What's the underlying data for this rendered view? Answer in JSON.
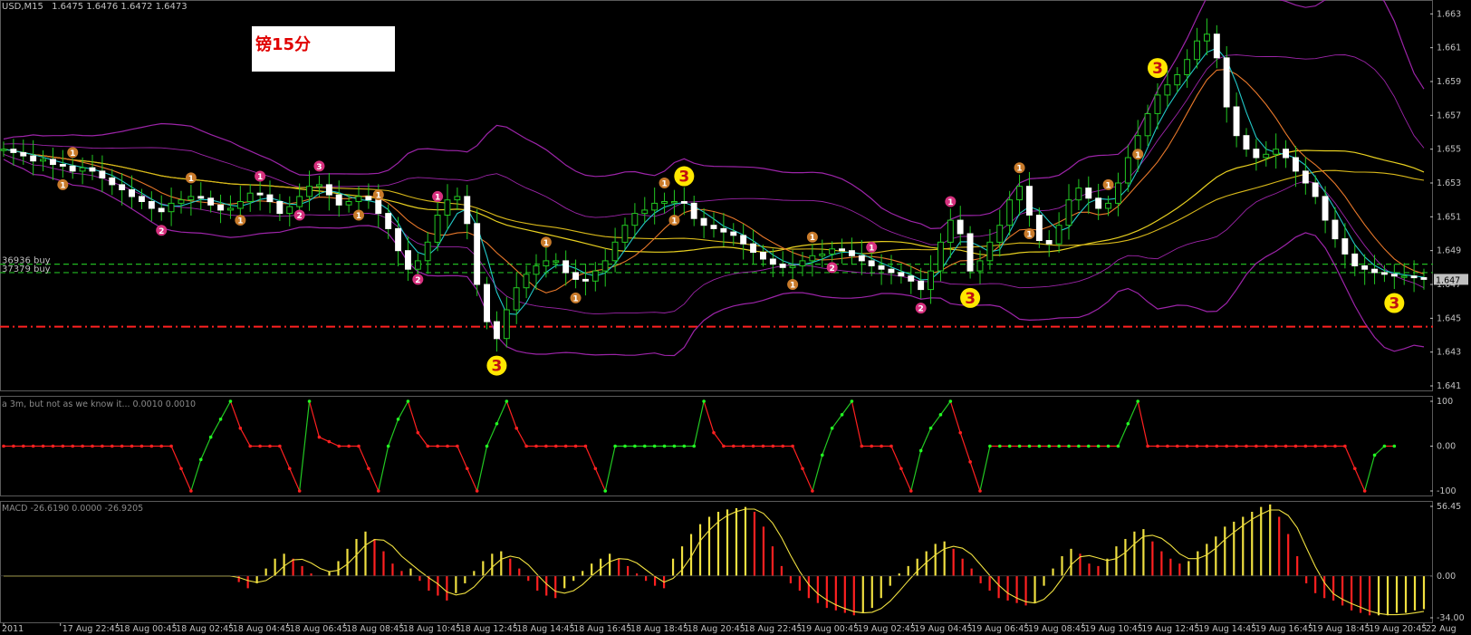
{
  "chart_data": [
    {
      "type": "candlestick",
      "title": "USD,M15",
      "ohlc_label": "1.6475 1.6476 1.6472 1.6473",
      "annotation_box": "镑15分",
      "ylim": [
        1.641,
        1.6635
      ],
      "y_ticks": [
        "1.663",
        "1.661",
        "1.659",
        "1.657",
        "1.655",
        "1.653",
        "1.651",
        "1.649",
        "1.647",
        "1.645",
        "1.643",
        "1.641"
      ],
      "current_price_tag": "1.647",
      "levels": [
        {
          "label": "36936 buy",
          "price": 1.6482,
          "style": "dashed",
          "color": "#22b822"
        },
        {
          "label": "37379 buy",
          "price": 1.6477,
          "style": "dashed",
          "color": "#22b822"
        },
        {
          "label": "",
          "price": 1.6445,
          "style": "dashdot",
          "color": "#ff2020"
        }
      ],
      "x_ticks": [
        "2011",
        "17 Aug 22:45",
        "18 Aug 00:45",
        "18 Aug 02:45",
        "18 Aug 04:45",
        "18 Aug 06:45",
        "18 Aug 08:45",
        "18 Aug 10:45",
        "18 Aug 12:45",
        "18 Aug 14:45",
        "18 Aug 16:45",
        "18 Aug 18:45",
        "18 Aug 20:45",
        "18 Aug 22:45",
        "19 Aug 00:45",
        "19 Aug 02:45",
        "19 Aug 04:45",
        "19 Aug 06:45",
        "19 Aug 08:45",
        "19 Aug 10:45",
        "19 Aug 12:45",
        "19 Aug 14:45",
        "19 Aug 16:45",
        "19 Aug 18:45",
        "19 Aug 20:45",
        "22 Aug"
      ],
      "close_series": [
        1.655,
        1.6548,
        1.6546,
        1.6543,
        1.6544,
        1.6541,
        1.654,
        1.6537,
        1.6539,
        1.6537,
        1.6533,
        1.6529,
        1.6526,
        1.6522,
        1.6519,
        1.6515,
        1.6513,
        1.6518,
        1.652,
        1.6522,
        1.6521,
        1.6517,
        1.6514,
        1.6515,
        1.6519,
        1.6524,
        1.6523,
        1.6519,
        1.6512,
        1.6516,
        1.6522,
        1.6528,
        1.6529,
        1.6523,
        1.6517,
        1.6519,
        1.6522,
        1.652,
        1.6512,
        1.6503,
        1.649,
        1.6479,
        1.6484,
        1.6495,
        1.6511,
        1.652,
        1.6522,
        1.6506,
        1.647,
        1.6448,
        1.6438,
        1.6455,
        1.6468,
        1.6476,
        1.6481,
        1.6484,
        1.6484,
        1.6477,
        1.6473,
        1.6472,
        1.6478,
        1.6484,
        1.6495,
        1.6505,
        1.6512,
        1.6514,
        1.6518,
        1.6519,
        1.6519,
        1.6518,
        1.6509,
        1.6505,
        1.6503,
        1.6501,
        1.6499,
        1.6494,
        1.6489,
        1.6485,
        1.6482,
        1.648,
        1.6481,
        1.6484,
        1.6487,
        1.6488,
        1.6491,
        1.649,
        1.6487,
        1.6484,
        1.6481,
        1.6479,
        1.6477,
        1.6475,
        1.6472,
        1.6467,
        1.6478,
        1.6495,
        1.6508,
        1.65,
        1.6478,
        1.6484,
        1.6495,
        1.6505,
        1.652,
        1.6528,
        1.6511,
        1.6496,
        1.6494,
        1.6505,
        1.652,
        1.6527,
        1.6521,
        1.6515,
        1.6518,
        1.653,
        1.6545,
        1.6558,
        1.6571,
        1.6582,
        1.6588,
        1.6594,
        1.6603,
        1.6614,
        1.6618,
        1.6604,
        1.6575,
        1.6558,
        1.655,
        1.6545,
        1.6547,
        1.655,
        1.6545,
        1.6537,
        1.653,
        1.6522,
        1.6508,
        1.6497,
        1.6488,
        1.6481,
        1.6479,
        1.6477,
        1.6476,
        1.6475,
        1.6475,
        1.6474,
        1.6473
      ],
      "markers": [
        {
          "i": 6,
          "label": "1",
          "color": "#c87a2a",
          "pos": "below",
          "size": "small"
        },
        {
          "i": 7,
          "label": "1",
          "color": "#c87a2a",
          "pos": "above",
          "size": "small"
        },
        {
          "i": 16,
          "label": "2",
          "color": "#d6307e",
          "pos": "below",
          "size": "small"
        },
        {
          "i": 19,
          "label": "1",
          "color": "#c87a2a",
          "pos": "above",
          "size": "small"
        },
        {
          "i": 24,
          "label": "1",
          "color": "#c87a2a",
          "pos": "below",
          "size": "small"
        },
        {
          "i": 26,
          "label": "1",
          "color": "#d6307e",
          "pos": "above",
          "size": "small"
        },
        {
          "i": 30,
          "label": "2",
          "color": "#d6307e",
          "pos": "below",
          "size": "small"
        },
        {
          "i": 32,
          "label": "3",
          "color": "#d6307e",
          "pos": "above",
          "size": "small"
        },
        {
          "i": 36,
          "label": "1",
          "color": "#c87a2a",
          "pos": "below",
          "size": "small"
        },
        {
          "i": 38,
          "label": "1",
          "color": "#c87a2a",
          "pos": "above",
          "size": "small"
        },
        {
          "i": 42,
          "label": "2",
          "color": "#d6307e",
          "pos": "below",
          "size": "small"
        },
        {
          "i": 44,
          "label": "1",
          "color": "#d6307e",
          "pos": "above",
          "size": "small"
        },
        {
          "i": 50,
          "label": "3",
          "color": "#ffe800",
          "pos": "below",
          "size": "big"
        },
        {
          "i": 55,
          "label": "1",
          "color": "#c87a2a",
          "pos": "above",
          "size": "small"
        },
        {
          "i": 58,
          "label": "1",
          "color": "#c87a2a",
          "pos": "below",
          "size": "small"
        },
        {
          "i": 67,
          "label": "1",
          "color": "#c87a2a",
          "pos": "above",
          "size": "small"
        },
        {
          "i": 68,
          "label": "1",
          "color": "#c87a2a",
          "pos": "below",
          "size": "small"
        },
        {
          "i": 69,
          "label": "3",
          "color": "#ffe800",
          "pos": "above",
          "size": "big"
        },
        {
          "i": 80,
          "label": "1",
          "color": "#c87a2a",
          "pos": "below",
          "size": "small"
        },
        {
          "i": 82,
          "label": "1",
          "color": "#c87a2a",
          "pos": "above",
          "size": "small"
        },
        {
          "i": 84,
          "label": "2",
          "color": "#d6307e",
          "pos": "below",
          "size": "small"
        },
        {
          "i": 88,
          "label": "1",
          "color": "#d6307e",
          "pos": "above",
          "size": "small"
        },
        {
          "i": 93,
          "label": "2",
          "color": "#d6307e",
          "pos": "below",
          "size": "small"
        },
        {
          "i": 96,
          "label": "1",
          "color": "#d6307e",
          "pos": "above",
          "size": "small"
        },
        {
          "i": 98,
          "label": "3",
          "color": "#ffe800",
          "pos": "below",
          "size": "big"
        },
        {
          "i": 103,
          "label": "1",
          "color": "#c87a2a",
          "pos": "above",
          "size": "small"
        },
        {
          "i": 104,
          "label": "1",
          "color": "#c87a2a",
          "pos": "below",
          "size": "small"
        },
        {
          "i": 112,
          "label": "1",
          "color": "#c87a2a",
          "pos": "above",
          "size": "small"
        },
        {
          "i": 115,
          "label": "1",
          "color": "#c87a2a",
          "pos": "below",
          "size": "small"
        },
        {
          "i": 117,
          "label": "3",
          "color": "#ffe800",
          "pos": "above",
          "size": "big"
        },
        {
          "i": 141,
          "label": "3",
          "color": "#ffe800",
          "pos": "below",
          "size": "big"
        }
      ],
      "colors": {
        "up": "#22c822",
        "down": "#ffffff",
        "bollinger": "#9c24a8",
        "ma_fast": "#22c8c8",
        "ma_mid": "#e8782a",
        "ma_slow": "#e8d020",
        "ma_slow2": "#d8b81a",
        "grid": "#303030",
        "axis_text": "#c0c0c0"
      }
    },
    {
      "type": "line",
      "title": "a 3m, but not as we know it... 0.0010 0.0010",
      "ylim": [
        -100,
        100
      ],
      "y_ticks": [
        "100",
        "0.00",
        "-100"
      ],
      "points": [
        {
          "i": 0,
          "v": 0
        },
        {
          "i": 17,
          "v": 0
        },
        {
          "i": 19,
          "v": -100
        },
        {
          "i": 20,
          "v": -30
        },
        {
          "i": 21,
          "v": 20
        },
        {
          "i": 23,
          "v": 100
        },
        {
          "i": 24,
          "v": 40
        },
        {
          "i": 25,
          "v": 0
        },
        {
          "i": 28,
          "v": 0
        },
        {
          "i": 30,
          "v": -100
        },
        {
          "i": 31,
          "v": 100
        },
        {
          "i": 32,
          "v": 20
        },
        {
          "i": 34,
          "v": 0
        },
        {
          "i": 36,
          "v": 0
        },
        {
          "i": 38,
          "v": -100
        },
        {
          "i": 39,
          "v": 0
        },
        {
          "i": 40,
          "v": 60
        },
        {
          "i": 41,
          "v": 100
        },
        {
          "i": 42,
          "v": 30
        },
        {
          "i": 43,
          "v": 0
        },
        {
          "i": 46,
          "v": 0
        },
        {
          "i": 48,
          "v": -100
        },
        {
          "i": 49,
          "v": 0
        },
        {
          "i": 51,
          "v": 100
        },
        {
          "i": 52,
          "v": 40
        },
        {
          "i": 53,
          "v": 0
        },
        {
          "i": 59,
          "v": 0
        },
        {
          "i": 61,
          "v": -100
        },
        {
          "i": 62,
          "v": 0
        },
        {
          "i": 70,
          "v": 0
        },
        {
          "i": 71,
          "v": 100
        },
        {
          "i": 72,
          "v": 30
        },
        {
          "i": 73,
          "v": 0
        },
        {
          "i": 80,
          "v": 0
        },
        {
          "i": 82,
          "v": -100
        },
        {
          "i": 83,
          "v": -20
        },
        {
          "i": 84,
          "v": 40
        },
        {
          "i": 86,
          "v": 100
        },
        {
          "i": 87,
          "v": 0
        },
        {
          "i": 90,
          "v": 0
        },
        {
          "i": 92,
          "v": -100
        },
        {
          "i": 93,
          "v": -10
        },
        {
          "i": 94,
          "v": 40
        },
        {
          "i": 96,
          "v": 100
        },
        {
          "i": 97,
          "v": 30
        },
        {
          "i": 99,
          "v": -100
        },
        {
          "i": 100,
          "v": 0
        },
        {
          "i": 113,
          "v": 0
        },
        {
          "i": 115,
          "v": 100
        },
        {
          "i": 116,
          "v": 0
        },
        {
          "i": 136,
          "v": 0
        },
        {
          "i": 138,
          "v": -100
        },
        {
          "i": 139,
          "v": -20
        },
        {
          "i": 140,
          "v": 0
        },
        {
          "i": 141,
          "v": 0
        }
      ],
      "colors": {
        "up": "#22c822",
        "down": "#ff2020",
        "dot_up": "#22ff22",
        "dot_down": "#ff2020"
      }
    },
    {
      "type": "bar",
      "title": "MACD -26.6190 0.0000 -26.9205",
      "ylim": [
        -34.0,
        56.45
      ],
      "y_ticks": [
        "56.45",
        "0.00",
        "-34.00"
      ],
      "values": [
        0,
        0,
        0,
        0,
        0,
        0,
        0,
        0,
        0,
        0,
        0,
        0,
        0,
        0,
        0,
        0,
        0,
        0,
        0,
        0,
        0,
        0,
        0,
        0,
        0,
        0,
        -5,
        -10,
        -6,
        6,
        14,
        18,
        14,
        8,
        2,
        0,
        4,
        12,
        22,
        30,
        36,
        30,
        20,
        10,
        4,
        6,
        -4,
        -12,
        -16,
        -20,
        -14,
        -6,
        4,
        12,
        18,
        20,
        14,
        6,
        -4,
        -12,
        -16,
        -18,
        -10,
        -4,
        4,
        10,
        14,
        18,
        14,
        8,
        2,
        -4,
        -8,
        -10,
        14,
        24,
        34,
        42,
        48,
        52,
        54,
        55,
        56,
        52,
        40,
        24,
        8,
        -6,
        -12,
        -18,
        -22,
        -26,
        -28,
        -30,
        -32,
        -30,
        -26,
        -18,
        -8,
        2,
        8,
        14,
        20,
        26,
        28,
        22,
        14,
        6,
        -6,
        -12,
        -18,
        -20,
        -22,
        -24,
        -22,
        -8,
        6,
        16,
        22,
        18,
        10,
        8,
        14,
        24,
        30,
        36,
        38,
        28,
        20,
        14,
        10,
        12,
        20,
        26,
        32,
        40,
        44,
        48,
        52,
        56,
        58,
        48,
        34,
        16,
        -6,
        -14,
        -18,
        -20,
        -24,
        -28,
        -30,
        -32,
        -32,
        -32,
        -30,
        -30,
        -28,
        -27
      ],
      "colors": {
        "pos_rise": "#f0e040",
        "pos_fall": "#ff2020",
        "neg_rise": "#f0e040",
        "neg_fall": "#ff2020",
        "signal": "#f0e040"
      }
    }
  ]
}
